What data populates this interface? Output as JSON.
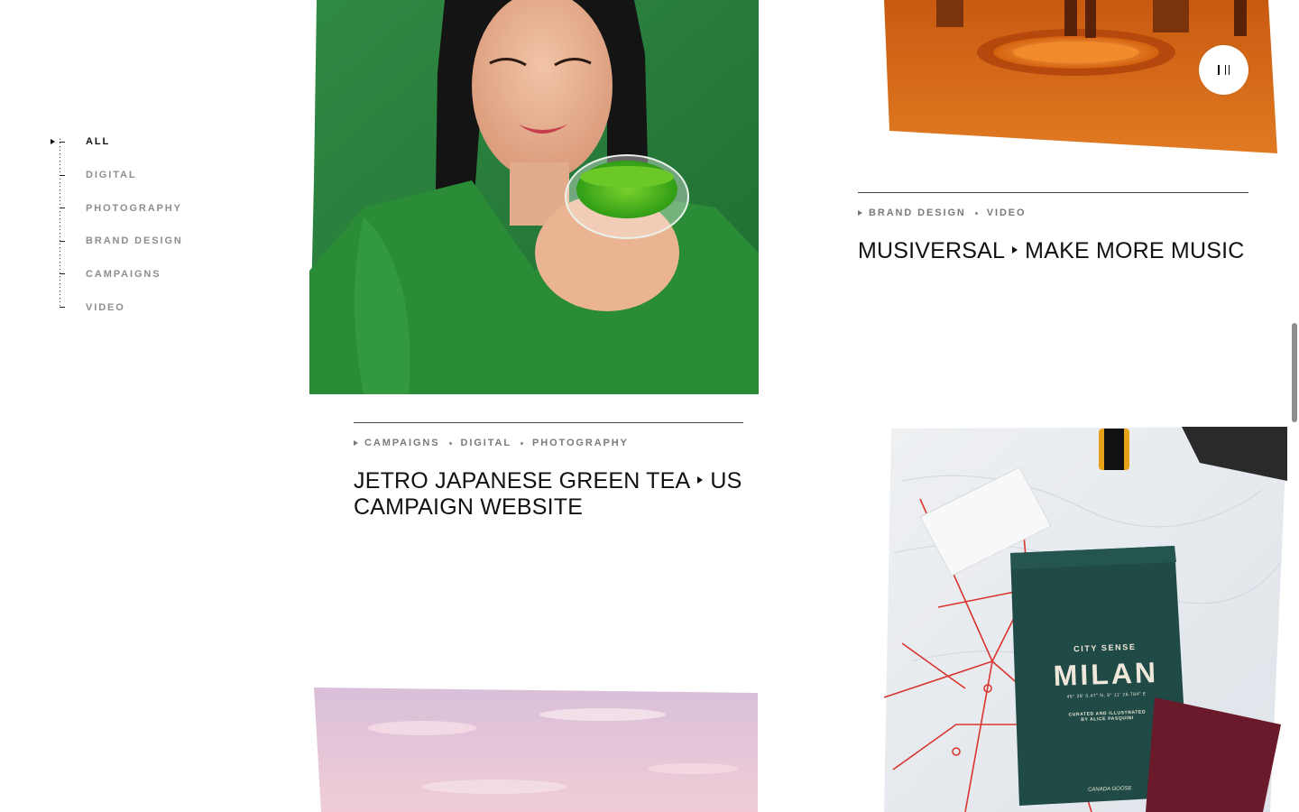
{
  "filters": {
    "items": [
      {
        "label": "ALL",
        "active": true
      },
      {
        "label": "DIGITAL",
        "active": false
      },
      {
        "label": "PHOTOGRAPHY",
        "active": false
      },
      {
        "label": "BRAND DESIGN",
        "active": false
      },
      {
        "label": "CAMPAIGNS",
        "active": false
      },
      {
        "label": "VIDEO",
        "active": false
      }
    ]
  },
  "projects": {
    "musiversal": {
      "tags": [
        "BRAND DESIGN",
        "VIDEO"
      ],
      "title_part1": "MUSIVERSAL",
      "title_part2": "MAKE MORE MUSIC"
    },
    "jetro": {
      "tags": [
        "CAMPAIGNS",
        "DIGITAL",
        "PHOTOGRAPHY"
      ],
      "title_part1": "JETRO JAPANESE GREEN TEA",
      "title_part2": "US CAMPAIGN WEBSITE"
    },
    "city_sense": {
      "book_brand": "CITY SENSE",
      "book_title": "MILAN",
      "book_coords": "45° 28' 0.47\" N, 9° 11' 26.784\" E",
      "book_credit_1": "CURATED AND ILLUSTRATED",
      "book_credit_2": "BY ALICE PASQUINI",
      "book_footer": "CANADA GOOSE"
    }
  },
  "colors": {
    "accent_text": "#111111",
    "muted_text": "#8e8e8e",
    "green_bg": "#2e7d3c",
    "orange_bg": "#d9651a",
    "sky_pink": "#e8c4d4"
  }
}
